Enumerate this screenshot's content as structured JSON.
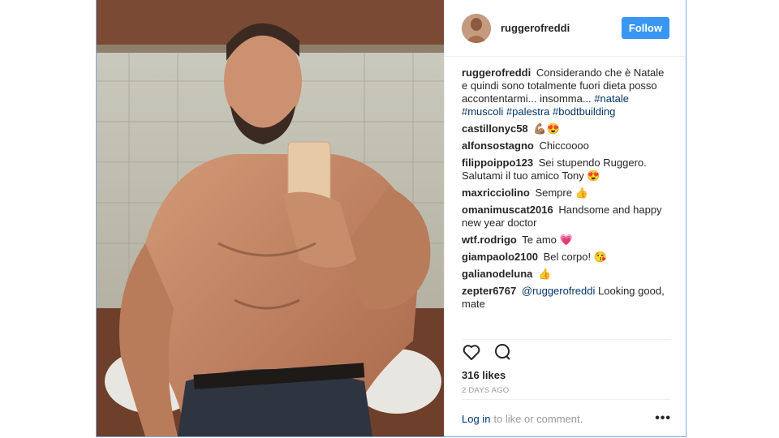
{
  "post": {
    "username": "ruggerofreddi",
    "follow_label": "Follow",
    "caption": {
      "user": "ruggerofreddi",
      "text": "Considerando che è Natale e quindi sono totalmente fuori dieta posso accontentarmi... insomma...",
      "tags": [
        "#natale",
        "#muscoli",
        "#palestra",
        "#bodtbuilding"
      ]
    },
    "comments": [
      {
        "user": "castillonyc58",
        "text": "💪🏽😍"
      },
      {
        "user": "alfonsostagno",
        "text": "Chiccoooo"
      },
      {
        "user": "filippoippo123",
        "text": "Sei stupendo Ruggero. Salutami il tuo amico Tony 😍"
      },
      {
        "user": "maxricciolino",
        "text": "Sempre 👍"
      },
      {
        "user": "omanimuscat2016",
        "text": "Handsome and happy new year doctor"
      },
      {
        "user": "wtf.rodrigo",
        "text": "Te amo 💗"
      },
      {
        "user": "giampaolo2100",
        "text": "Bel corpo! 😘"
      },
      {
        "user": "galianodeluna",
        "text": "👍"
      },
      {
        "user": "zepter6767",
        "mention": "@ruggerofreddi",
        "text": "Looking good, mate"
      }
    ],
    "likes": "316 likes",
    "time": "2 DAYS AGO",
    "login_link": "Log in",
    "login_rest": "to like or comment.",
    "more": "•••"
  },
  "icons": {
    "like": "heart-icon",
    "comment": "comment-bubble-icon",
    "more": "more-options-icon"
  },
  "colors": {
    "follow_bg": "#3897f0",
    "tag": "#003569",
    "muted": "#999999",
    "border": "#7fa9d8"
  }
}
